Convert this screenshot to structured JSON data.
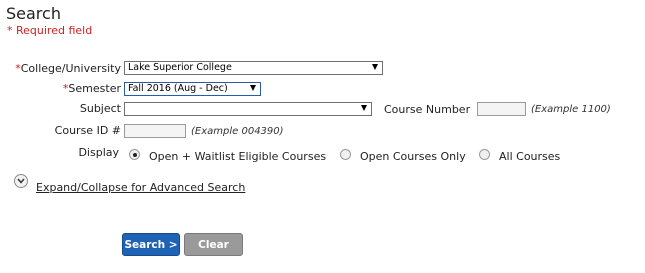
{
  "page": {
    "title": "Search",
    "required_note": "* Required field"
  },
  "form": {
    "college": {
      "star": "*",
      "label": "College/University",
      "value": "Lake Superior College"
    },
    "semester": {
      "star": "*",
      "label": "Semester",
      "value": "Fall 2016 (Aug - Dec)"
    },
    "subject": {
      "label": "Subject",
      "value": ""
    },
    "course_number": {
      "label": "Course Number",
      "value": "",
      "example": "(Example 1100)"
    },
    "course_id": {
      "label": "Course ID #",
      "value": "",
      "example": "(Example 004390)"
    },
    "display": {
      "label": "Display",
      "options": [
        {
          "label": "Open + Waitlist Eligible Courses",
          "selected": true
        },
        {
          "label": "Open Courses Only",
          "selected": false
        },
        {
          "label": "All Courses",
          "selected": false
        }
      ]
    }
  },
  "advanced": {
    "link_label": "Expand/Collapse for Advanced Search"
  },
  "buttons": {
    "search_label": "Search >",
    "clear_label": "Clear"
  },
  "colors": {
    "required": "#cc2222",
    "search_button": "#1f63b6",
    "clear_button": "#9a9a9a"
  }
}
